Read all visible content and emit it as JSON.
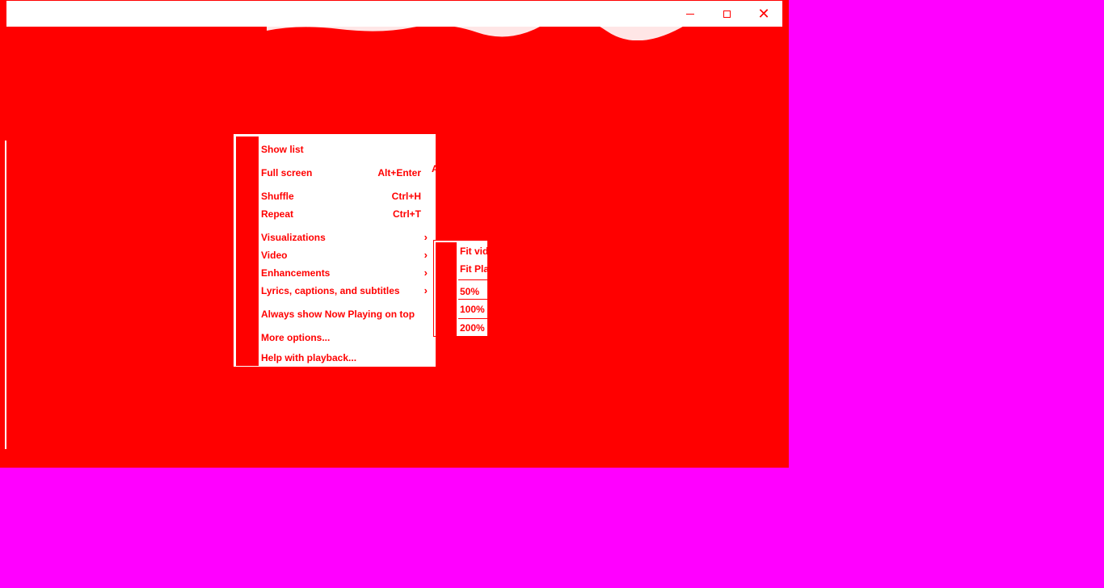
{
  "window": {
    "title": "",
    "minimize_icon": "minimize-icon",
    "maximize_icon": "maximize-icon",
    "close_icon": "close-icon"
  },
  "context_menu": {
    "items": [
      {
        "label": "Show list",
        "shortcut": ""
      },
      {
        "label": "Full screen",
        "shortcut": "Alt+Enter"
      },
      {
        "label": "Shuffle",
        "shortcut": "Ctrl+H"
      },
      {
        "label": "Repeat",
        "shortcut": "Ctrl+T"
      },
      {
        "label": "Visualizations",
        "submenu": true
      },
      {
        "label": "Video",
        "submenu": true
      },
      {
        "label": "Enhancements",
        "submenu": true
      },
      {
        "label": "Lyrics, captions, and subtitles",
        "submenu": true
      },
      {
        "label": "Always show Now Playing on top",
        "shortcut": ""
      },
      {
        "label": "More options...",
        "shortcut": ""
      },
      {
        "label": "Help with playback...",
        "shortcut": ""
      }
    ]
  },
  "video_submenu": {
    "items": [
      {
        "label": "Fit video to player"
      },
      {
        "label": "Fit Player to video"
      },
      {
        "label": "50%"
      },
      {
        "label": "100%"
      },
      {
        "label": "200%"
      }
    ]
  },
  "colors": {
    "window_bg": "#ff0000",
    "desktop_bg": "#ff00ff",
    "menu_bg": "#ffffff",
    "text": "#ff0000"
  }
}
